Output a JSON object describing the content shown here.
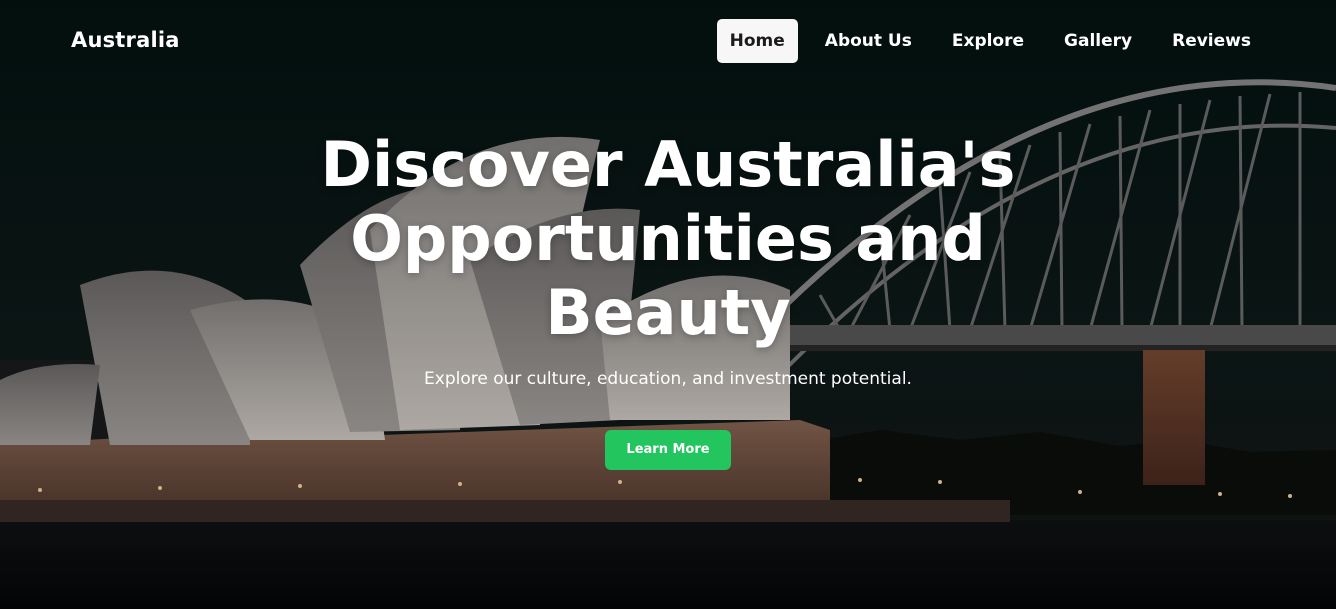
{
  "nav": {
    "brand": "Australia",
    "links": [
      {
        "label": "Home",
        "active": true
      },
      {
        "label": "About Us",
        "active": false
      },
      {
        "label": "Explore",
        "active": false
      },
      {
        "label": "Gallery",
        "active": false
      },
      {
        "label": "Reviews",
        "active": false
      }
    ]
  },
  "hero": {
    "title": "Discover Australia's Opportunities and Beauty",
    "subtitle": "Explore our culture, education, and investment potential.",
    "cta_label": "Learn More"
  },
  "colors": {
    "cta": "#22c55e",
    "active_nav_bg": "#f7f7f7",
    "text": "#ffffff"
  }
}
